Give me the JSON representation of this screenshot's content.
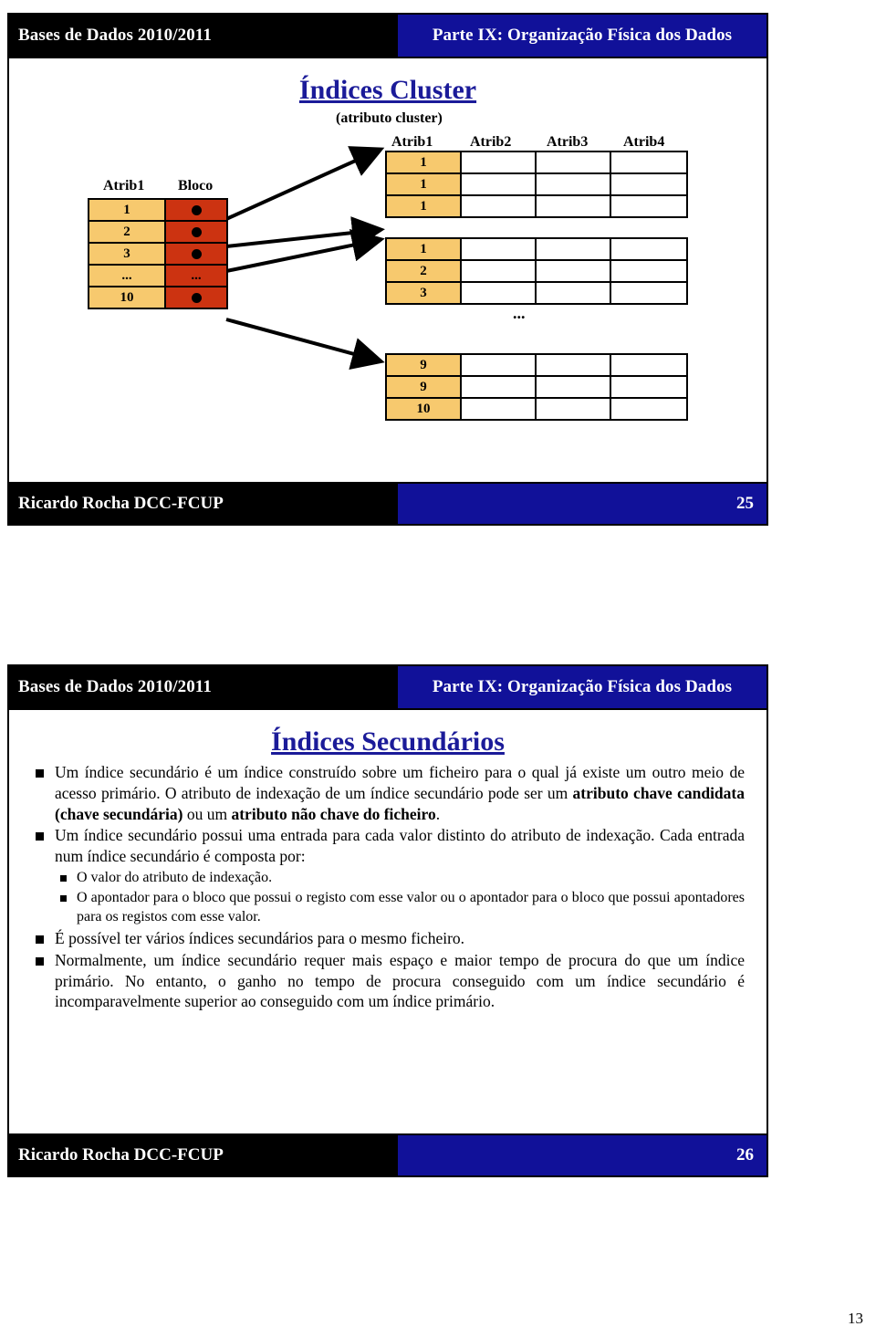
{
  "document": {
    "page_number": "13"
  },
  "slides": [
    {
      "header_left": "Bases de Dados 2010/2011",
      "header_right": "Parte IX: Organização Física dos Dados",
      "title": "Índices Cluster",
      "footer_left": "Ricardo Rocha DCC-FCUP",
      "footer_right": "25"
    },
    {
      "header_left": "Bases de Dados 2010/2011",
      "header_right": "Parte IX: Organização Física dos Dados",
      "title": "Índices Secundários",
      "footer_left": "Ricardo Rocha DCC-FCUP",
      "footer_right": "26"
    }
  ],
  "diagram": {
    "cluster_caption": "(atributo cluster)",
    "index_table": {
      "headers": [
        "Atrib1",
        "Bloco"
      ],
      "rows": [
        {
          "key": "1",
          "pointer": "dot"
        },
        {
          "key": "2",
          "pointer": "dot"
        },
        {
          "key": "3",
          "pointer": "dot"
        },
        {
          "key": "...",
          "pointer": "..."
        },
        {
          "key": "10",
          "pointer": "dot"
        }
      ]
    },
    "data_headers": [
      "Atrib1",
      "Atrib2",
      "Atrib3",
      "Atrib4"
    ],
    "blocks": [
      {
        "values": [
          "1",
          "1",
          "1"
        ]
      },
      {
        "values": [
          "1",
          "2",
          "3"
        ]
      },
      {
        "values": [
          "9",
          "9",
          "10"
        ]
      }
    ],
    "ellipsis": "...",
    "colors": {
      "key_cell": "#f7c96e",
      "pointer_cell": "#cc3311",
      "title_blue": "#1b1b99",
      "header_blue": "#111199",
      "header_black": "#000000"
    }
  },
  "secondary_index": {
    "bullets": [
      {
        "parts": [
          {
            "text": "Um índice secundário é um índice construído sobre um ficheiro para o qual já existe um outro meio de acesso primário. O atributo de indexação de um índice secundário pode ser um ",
            "bold": false
          },
          {
            "text": "atributo chave candidata (chave secundária)",
            "bold": true
          },
          {
            "text": " ou um ",
            "bold": false
          },
          {
            "text": "atributo não chave do ficheiro",
            "bold": true
          },
          {
            "text": ".",
            "bold": false
          }
        ],
        "sub": []
      },
      {
        "parts": [
          {
            "text": "Um índice secundário possui uma entrada para cada valor distinto do atributo de indexação. Cada entrada num índice secundário é composta por:",
            "bold": false
          }
        ],
        "sub": [
          "O valor do atributo de indexação.",
          "O apontador para o bloco que possui o registo com esse valor ou o apontador para o bloco que possui apontadores para os registos com esse valor."
        ]
      },
      {
        "parts": [
          {
            "text": "É possível ter vários índices secundários para o mesmo ficheiro.",
            "bold": false
          }
        ],
        "sub": []
      },
      {
        "parts": [
          {
            "text": "Normalmente, um índice secundário requer mais espaço e maior tempo de procura do que um índice primário. No entanto, o ganho no tempo de procura conseguido com um índice secundário é incomparavelmente superior ao conseguido com um índice primário.",
            "bold": false
          }
        ],
        "sub": []
      }
    ]
  }
}
